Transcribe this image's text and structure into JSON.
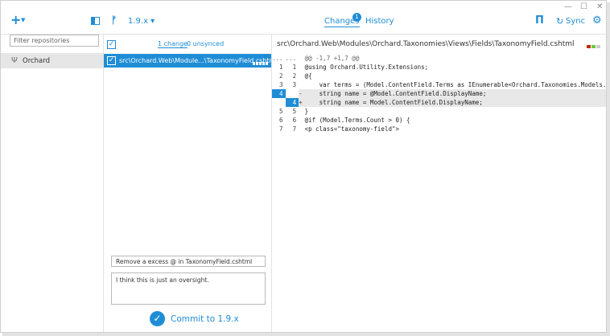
{
  "window": {
    "controls": {
      "minimize": "—",
      "maximize": "☐",
      "close": "✕"
    }
  },
  "toolbar": {
    "add_symbol": "+",
    "branch": "1.9.x ▾",
    "tabs": [
      {
        "label": "Changes",
        "active": true,
        "badge": "1"
      },
      {
        "label": "History",
        "active": false
      }
    ],
    "sync_label": "Sync"
  },
  "sidebar": {
    "filter_placeholder": "Filter repositories",
    "repos": [
      {
        "label": "Orchard",
        "selected": true
      }
    ]
  },
  "changes": {
    "change_count": "1 change",
    "unsynced": "0 unsynced",
    "files": [
      {
        "path": "src\\Orchard.Web\\Module...\\TaxonomyField.cshtml",
        "checked": true
      }
    ],
    "summary_value": "Remove a excess @ in TaxonomyField.cshtml",
    "description_value": "I think this is just an oversight.",
    "commit_label": "Commit to 1.9.x"
  },
  "diff": {
    "path": "src\\Orchard.Web\\Modules\\Orchard.Taxonomies\\Views\\Fields\\TaxonomyField.cshtml",
    "colors": {
      "added": "#6cc644",
      "removed": "#bd2c00",
      "neutral": "#cccccc",
      "accent": "#1f8dd6"
    },
    "lines": [
      {
        "old": "...",
        "new": "...",
        "sign": "",
        "text": "@@ -1,7 +1,7 @@",
        "kind": "hunk"
      },
      {
        "old": "1",
        "new": "1",
        "sign": "",
        "text": "@using Orchard.Utility.Extensions;",
        "kind": "ctx"
      },
      {
        "old": "2",
        "new": "2",
        "sign": "",
        "text": "@{",
        "kind": "ctx"
      },
      {
        "old": "3",
        "new": "3",
        "sign": "",
        "text": "    var terms = (Model.ContentField.Terms as IEnumerable<Orchard.Taxonomies.Models.TermPart>)Model.Terms;",
        "kind": "ctx"
      },
      {
        "old": "4",
        "new": "",
        "sign": "-",
        "text": "    string name = @Model.ContentField.DisplayName;",
        "kind": "del"
      },
      {
        "old": "",
        "new": "4",
        "sign": "+",
        "text": "    string name = Model.ContentField.DisplayName;",
        "kind": "add"
      },
      {
        "old": "5",
        "new": "5",
        "sign": "",
        "text": "}",
        "kind": "ctx"
      },
      {
        "old": "6",
        "new": "6",
        "sign": "",
        "text": "@if (Model.Terms.Count > 0) {",
        "kind": "ctx"
      },
      {
        "old": "7",
        "new": "7",
        "sign": "",
        "text": "<p class=\"taxonomy-field\">",
        "kind": "ctx"
      }
    ]
  }
}
